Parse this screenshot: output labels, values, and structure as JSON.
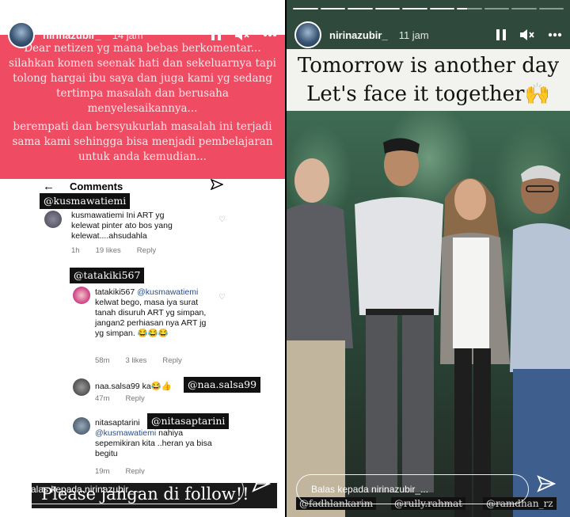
{
  "left_story": {
    "username": "nirinazubir_",
    "time": "14 jam",
    "banner_paragraphs": [
      "Dear netizen yg mana bebas berkomentar... silahkan komen seenak hati dan sekeluarnya tapi tolong hargai ibu saya dan juga kami yg sedang tertimpa masalah dan berusaha menyelesaikannya...",
      "berempati dan bersyukurlah masalah ini terjadi sama kami sehingga bisa menjadi pembelajaran untuk anda kemudian..."
    ],
    "comments_title": "Comments",
    "comments": [
      {
        "tag": "@kusmawatiemi",
        "user": "kusmawatiemi",
        "text": "Ini ART yg kelewat pinter ato bos yang kelewat....ahsudahla",
        "age": "1h",
        "likes": "19 likes",
        "reply": "Reply"
      },
      {
        "tag": "@tatakiki567",
        "user": "tatakiki567",
        "mention": "@kusmawatiemi",
        "text": "kelwat bego, masa iya surat tanah disuruh ART yg simpan, jangan2 perhiasan nya ART jg yg simpan. 😂😂😂",
        "age": "58m",
        "likes": "3 likes",
        "reply": "Reply"
      },
      {
        "tag": "@naa.salsa99",
        "user": "naa.salsa99",
        "text": "ka😂👍",
        "age": "47m",
        "reply": "Reply"
      },
      {
        "tag": "@nitasaptarini",
        "user": "nitasaptarini",
        "mention": "@kusmawatiemi",
        "text": "nahiya sepemikiran kita ..heran ya bisa begitu",
        "age": "19m",
        "reply": "Reply"
      }
    ],
    "footer_text": "Please jangan di follow!!",
    "reply_placeholder": "Balas kepada nirinazubir_..."
  },
  "right_story": {
    "username": "nirinazubir_",
    "time": "11 jam",
    "caption_line1": "Tomorrow is another day",
    "caption_line2": "Let's face it together🙌",
    "tags": [
      "@fadhlankarim",
      "@rully.rahmat",
      "@ramdhan_rz"
    ],
    "reply_placeholder": "Balas kepada nirinazubir_..."
  },
  "colors": {
    "banner_pink": "#ef4b63",
    "tag_box": "#111111",
    "caption_bg": "#f2f2ee"
  },
  "icons": [
    "pause-icon",
    "mute-icon",
    "more-icon",
    "send-icon",
    "back-arrow-icon",
    "heart-icon"
  ]
}
